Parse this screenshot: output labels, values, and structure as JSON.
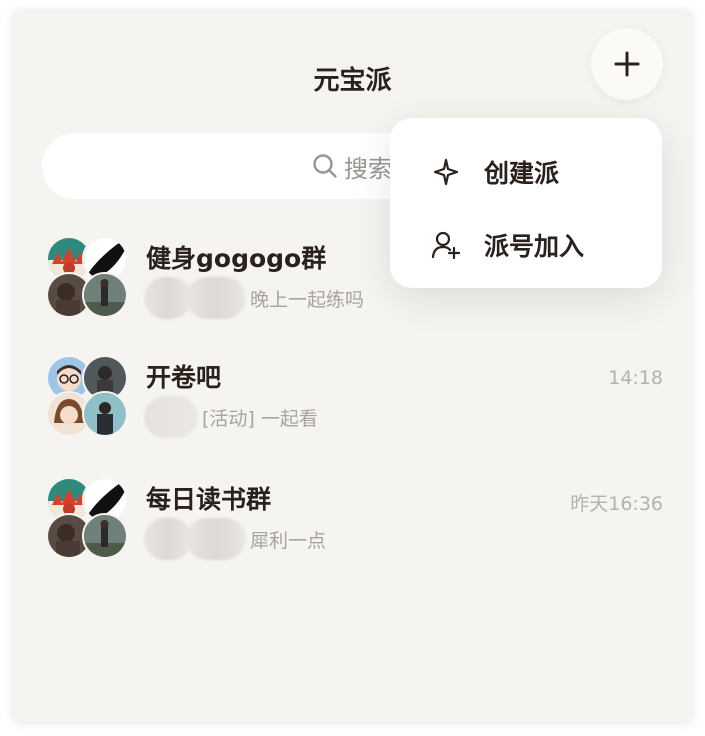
{
  "header": {
    "title": "元宝派"
  },
  "search": {
    "placeholder": "搜索"
  },
  "chats": [
    {
      "name": "健身gogogo群",
      "time": "",
      "preview": "晚上一起练吗"
    },
    {
      "name": "开卷吧",
      "time": "14:18",
      "preview": "[活动] 一起看"
    },
    {
      "name": "每日读书群",
      "time": "昨天16:36",
      "preview": "犀利一点"
    }
  ],
  "menu": {
    "items": [
      {
        "label": "创建派",
        "icon": "sparkle-icon"
      },
      {
        "label": "派号加入",
        "icon": "user-add-icon"
      }
    ]
  },
  "colors": {
    "background": "#f5f4f0",
    "text": "#2a211c",
    "muted": "#a8a39d"
  }
}
